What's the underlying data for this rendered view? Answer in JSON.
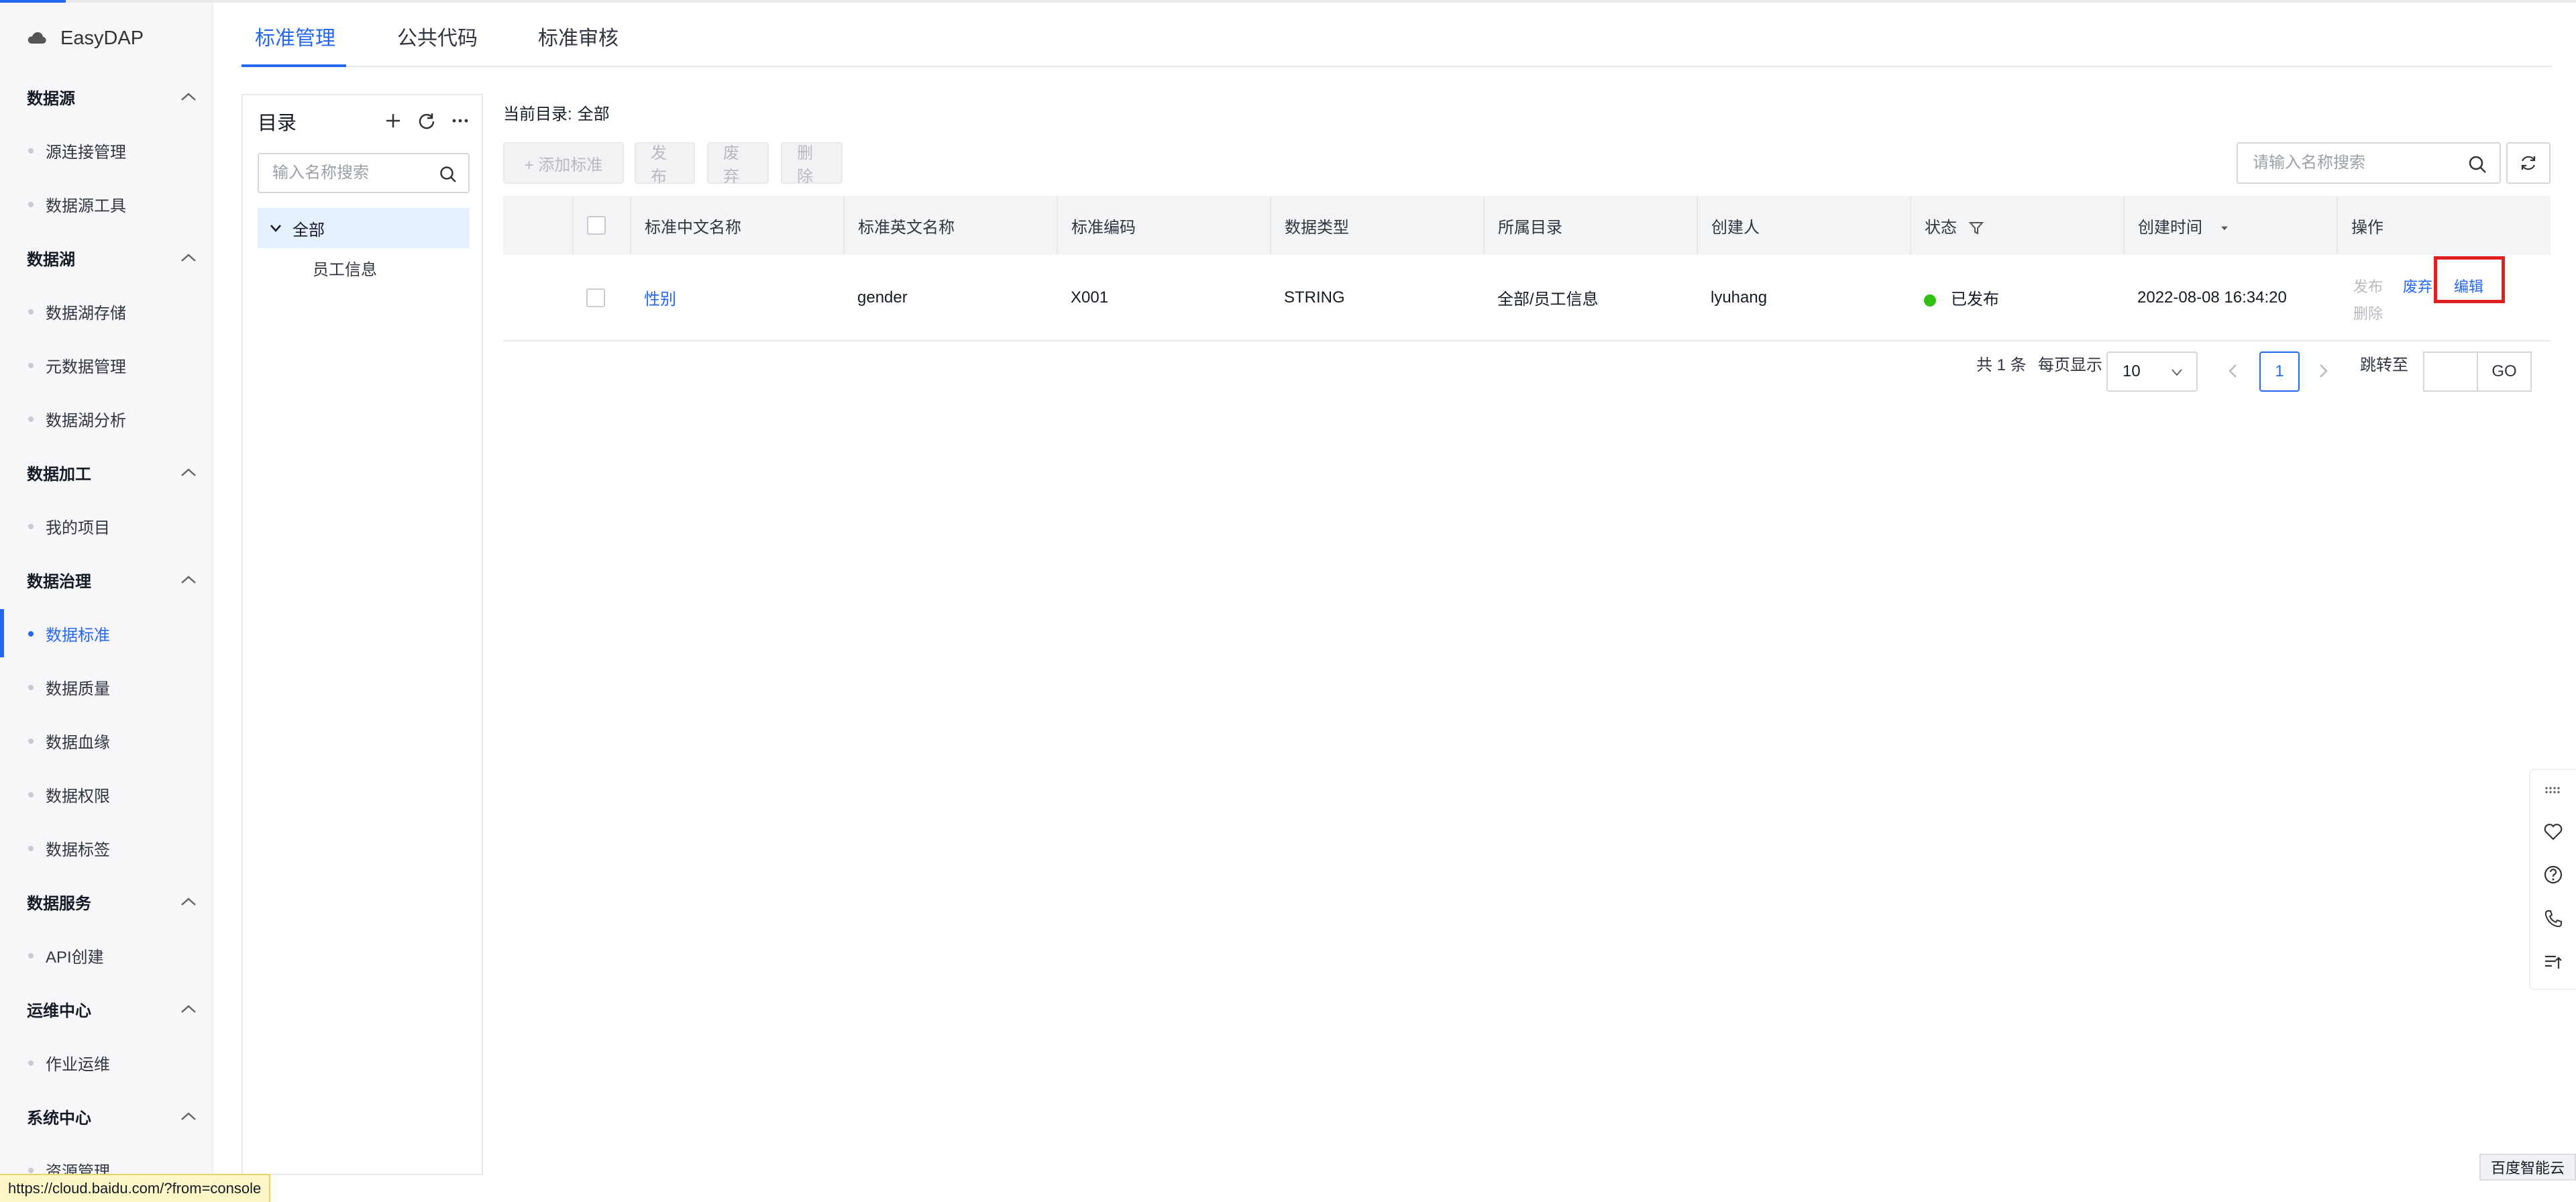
{
  "app": {
    "name": "EasyDAP"
  },
  "sidebar": {
    "groups": [
      {
        "label": "数据源",
        "items": [
          "源连接管理",
          "数据源工具"
        ]
      },
      {
        "label": "数据湖",
        "items": [
          "数据湖存储",
          "元数据管理",
          "数据湖分析"
        ]
      },
      {
        "label": "数据加工",
        "items": [
          "我的项目"
        ]
      },
      {
        "label": "数据治理",
        "items": [
          "数据标准",
          "数据质量",
          "数据血缘",
          "数据权限",
          "数据标签"
        ]
      },
      {
        "label": "数据服务",
        "items": [
          "API创建"
        ]
      },
      {
        "label": "运维中心",
        "items": [
          "作业运维"
        ]
      },
      {
        "label": "系统中心",
        "items": [
          "资源管理"
        ]
      }
    ],
    "active_item": "数据标准"
  },
  "tabs": [
    "标准管理",
    "公共代码",
    "标准审核"
  ],
  "active_tab": "标准管理",
  "directory": {
    "title": "目录",
    "search_placeholder": "输入名称搜索",
    "root": "全部",
    "children": [
      "员工信息"
    ]
  },
  "crumb": {
    "label": "当前目录:",
    "value": "全部"
  },
  "toolbar": {
    "add": "+ 添加标准",
    "publish": "发布",
    "abandon": "废弃",
    "delete": "删除",
    "search_placeholder": "请输入名称搜索"
  },
  "table": {
    "columns": [
      "标准中文名称",
      "标准英文名称",
      "标准编码",
      "数据类型",
      "所属目录",
      "创建人",
      "状态",
      "创建时间",
      "操作"
    ],
    "rows": [
      {
        "cn_name": "性别",
        "en_name": "gender",
        "code": "X001",
        "type": "STRING",
        "dir": "全部/员工信息",
        "creator": "lyuhang",
        "status": "已发布",
        "created": "2022-08-08 16:34:20",
        "ops": {
          "publish": "发布",
          "abandon": "废弃",
          "edit": "编辑",
          "delete": "删除"
        }
      }
    ]
  },
  "pagination": {
    "total": "共 1 条",
    "per_page_label": "每页显示",
    "per_page": "10",
    "current": "1",
    "jump_label": "跳转至",
    "go": "GO"
  },
  "footer": {
    "brand": "百度智能云",
    "url": "https://cloud.baidu.com/?from=console"
  },
  "colors": {
    "accent": "#2468f2",
    "status_ok": "#30bf13",
    "highlight": "#e02020"
  }
}
